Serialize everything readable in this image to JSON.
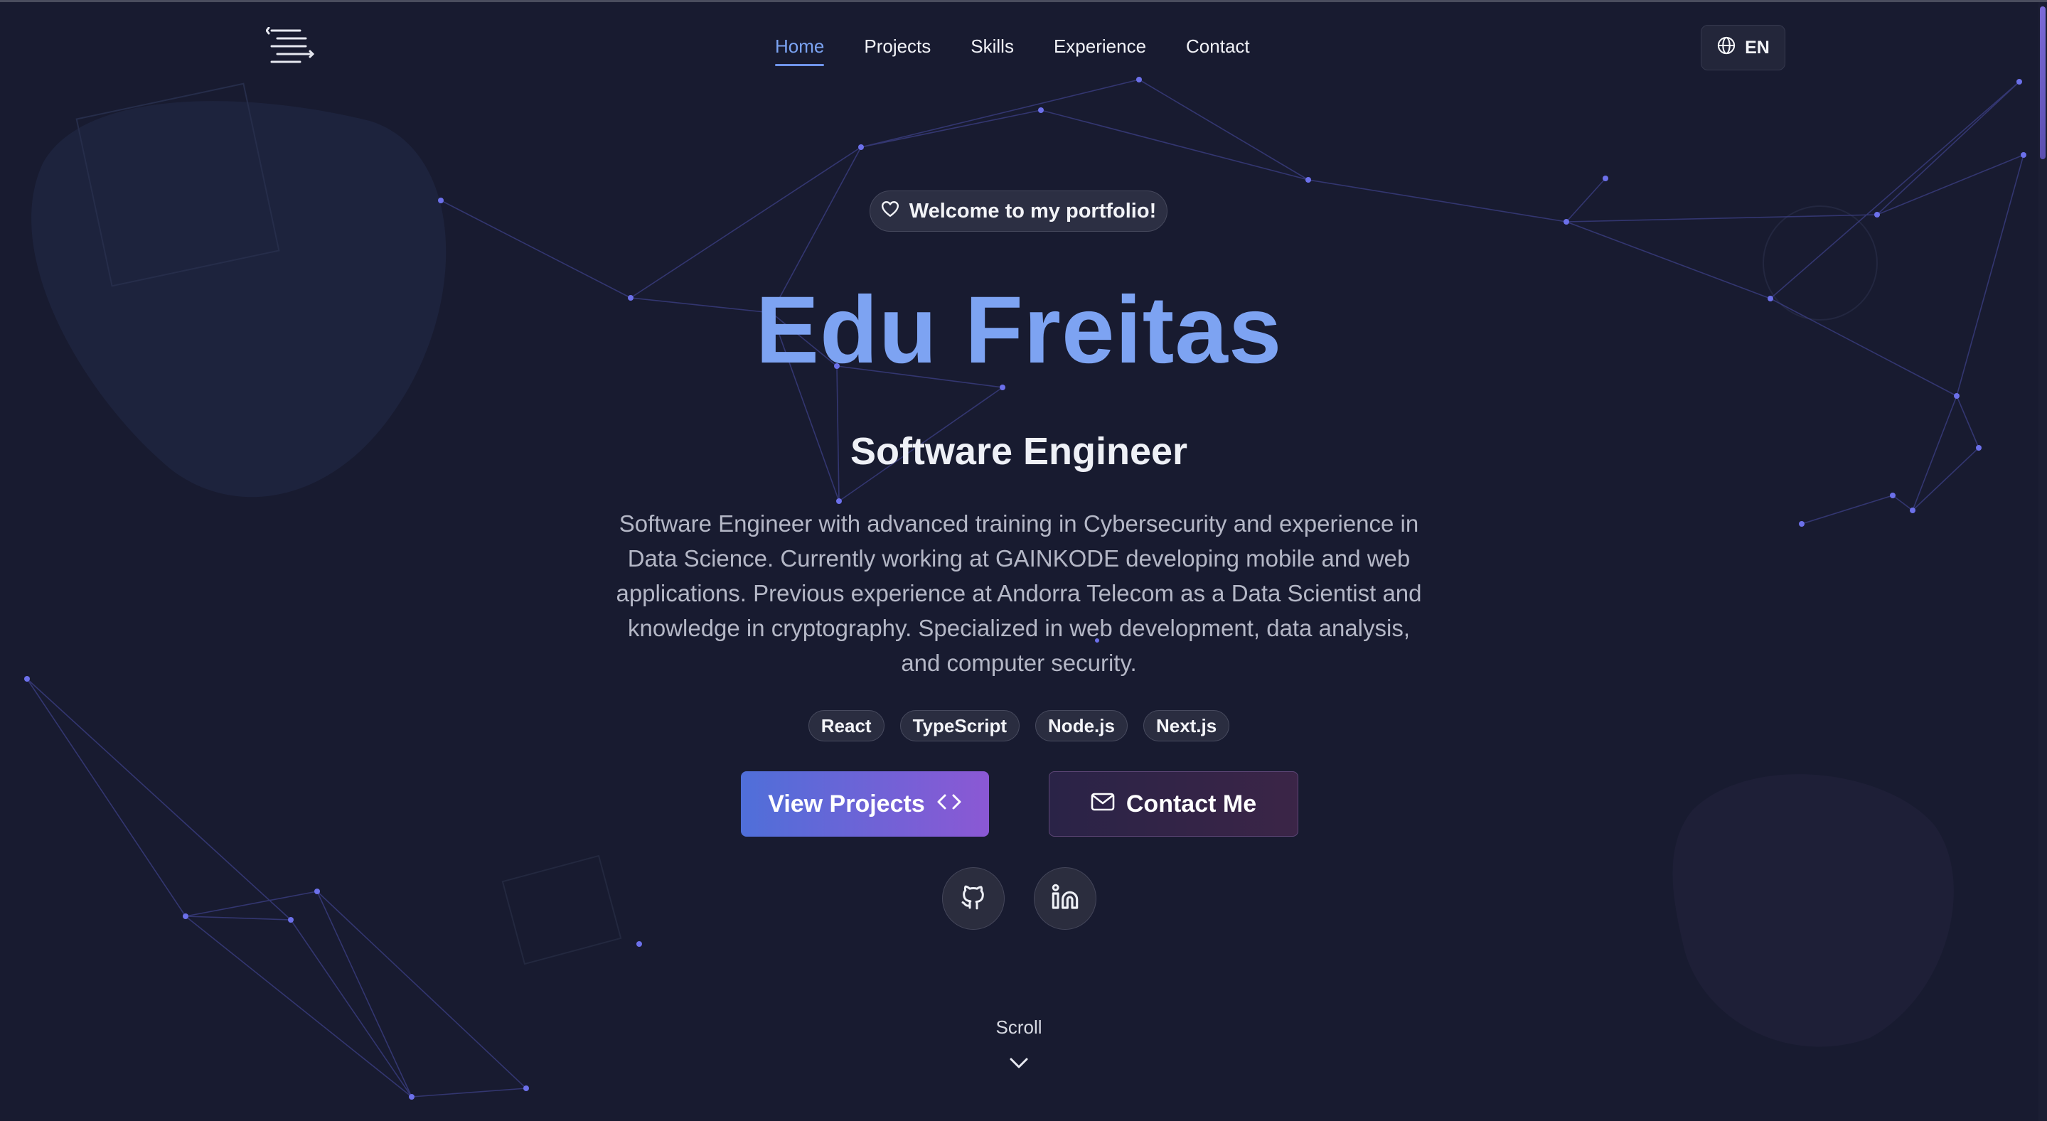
{
  "header": {
    "logo_icon": "menu-lines-icon",
    "nav": [
      {
        "label": "Home",
        "active": true
      },
      {
        "label": "Projects",
        "active": false
      },
      {
        "label": "Skills",
        "active": false
      },
      {
        "label": "Experience",
        "active": false
      },
      {
        "label": "Contact",
        "active": false
      }
    ],
    "language": {
      "icon": "globe-icon",
      "label": "EN"
    }
  },
  "hero": {
    "welcome_badge": {
      "icon": "heart-icon",
      "label": "Welcome to my portfolio!"
    },
    "name": "Edu Freitas",
    "role": "Software Engineer",
    "description": "Software Engineer with advanced training in Cybersecurity and experience in Data Science. Currently working at GAINKODE developing mobile and web applications. Previous experience at Andorra Telecom as a Data Scientist and knowledge in cryptography. Specialized in web development, data analysis, and computer security.",
    "tags": [
      "React",
      "TypeScript",
      "Node.js",
      "Next.js"
    ],
    "buttons": {
      "view_projects": {
        "label": "View Projects",
        "icon": "code-brackets-icon"
      },
      "contact_me": {
        "label": "Contact Me",
        "icon": "mail-icon"
      }
    },
    "social": [
      {
        "name": "github",
        "icon": "github-icon"
      },
      {
        "name": "linkedin",
        "icon": "linkedin-icon"
      }
    ],
    "scroll": {
      "label": "Scroll",
      "icon": "chevron-down-icon"
    }
  },
  "colors": {
    "background": "#181b30",
    "accent": "#7da3f2",
    "button_gradient_start": "#4f6fd9",
    "button_gradient_end": "#8b58d4"
  }
}
